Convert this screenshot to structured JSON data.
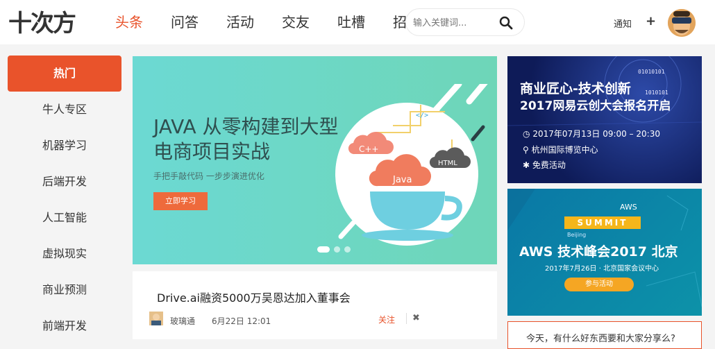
{
  "header": {
    "logo_text": "十次方",
    "nav": [
      "头条",
      "问答",
      "活动",
      "交友",
      "吐槽",
      "招聘"
    ],
    "search_placeholder": "输入关键词...",
    "notify_label": "通知",
    "plus_label": "+",
    "accent_color": "#e8522a"
  },
  "sidebar": {
    "items": [
      "热门",
      "牛人专区",
      "机器学习",
      "后端开发",
      "人工智能",
      "虚拟现实",
      "商业预测",
      "前端开发"
    ],
    "active_index": 0
  },
  "banner": {
    "title_line1": "JAVA 从零构建到大型",
    "title_line2": "电商项目实战",
    "subtitle": "手把手敲代码  一步步演进优化",
    "button_label": "立即学习",
    "cloud_labels": [
      "C++",
      "Java",
      "HTML",
      "</>"
    ],
    "slide_count": 3,
    "active_slide": 0
  },
  "article": {
    "title": "Drive.ai融资5000万吴恩达加入董事会",
    "author": "玻璃通",
    "time": "6月22日 12:01",
    "follow_label": "关注",
    "close_label": "✖"
  },
  "ads": {
    "ad1": {
      "title1": "商业匠心-技术创新",
      "title2": "2017网易云创大会报名开启",
      "date": "2017年07月13日 09:00 – 20:30",
      "location": "杭州国际博览中心",
      "price": "免费活动",
      "binary": [
        "01010101",
        "1010101"
      ]
    },
    "ad2": {
      "aws_label": "AWS",
      "summit_label": "SUMMIT",
      "city_label": "Beijing",
      "title": "AWS 技术峰会2017 北京",
      "date": "2017年7月26日 · 北京国家会议中心",
      "button_label": "参与活动"
    }
  },
  "share": {
    "text": "今天，有什么好东西要和大家分享么?"
  }
}
